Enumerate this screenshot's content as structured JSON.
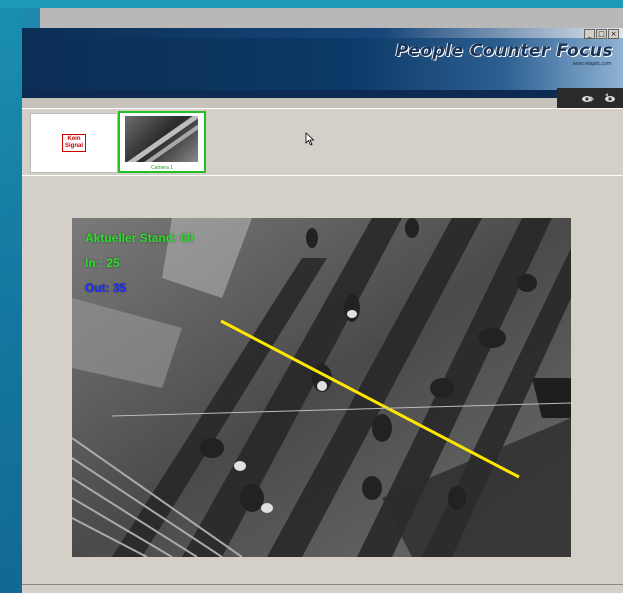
{
  "window": {
    "title": "People Counter Focus",
    "url": "www.vitaptic.com",
    "controls": [
      "_",
      "□",
      "×"
    ]
  },
  "toolbar": {
    "icons": [
      "eye-forward-icon",
      "eye-settings-icon"
    ]
  },
  "thumbnails": [
    {
      "label": "Kein\nSignal",
      "type": "no-signal"
    },
    {
      "label": "Camera 1",
      "type": "camera",
      "selected": true
    }
  ],
  "video_overlay": {
    "stand": "Aktueller Stand: 60",
    "in": "In   : 25",
    "out": "Out: 35"
  },
  "colors": {
    "in_text": "#2ddc2d",
    "out_text": "#1a2cff",
    "count_line": "#ffe800",
    "selected_border": "#22c022"
  }
}
